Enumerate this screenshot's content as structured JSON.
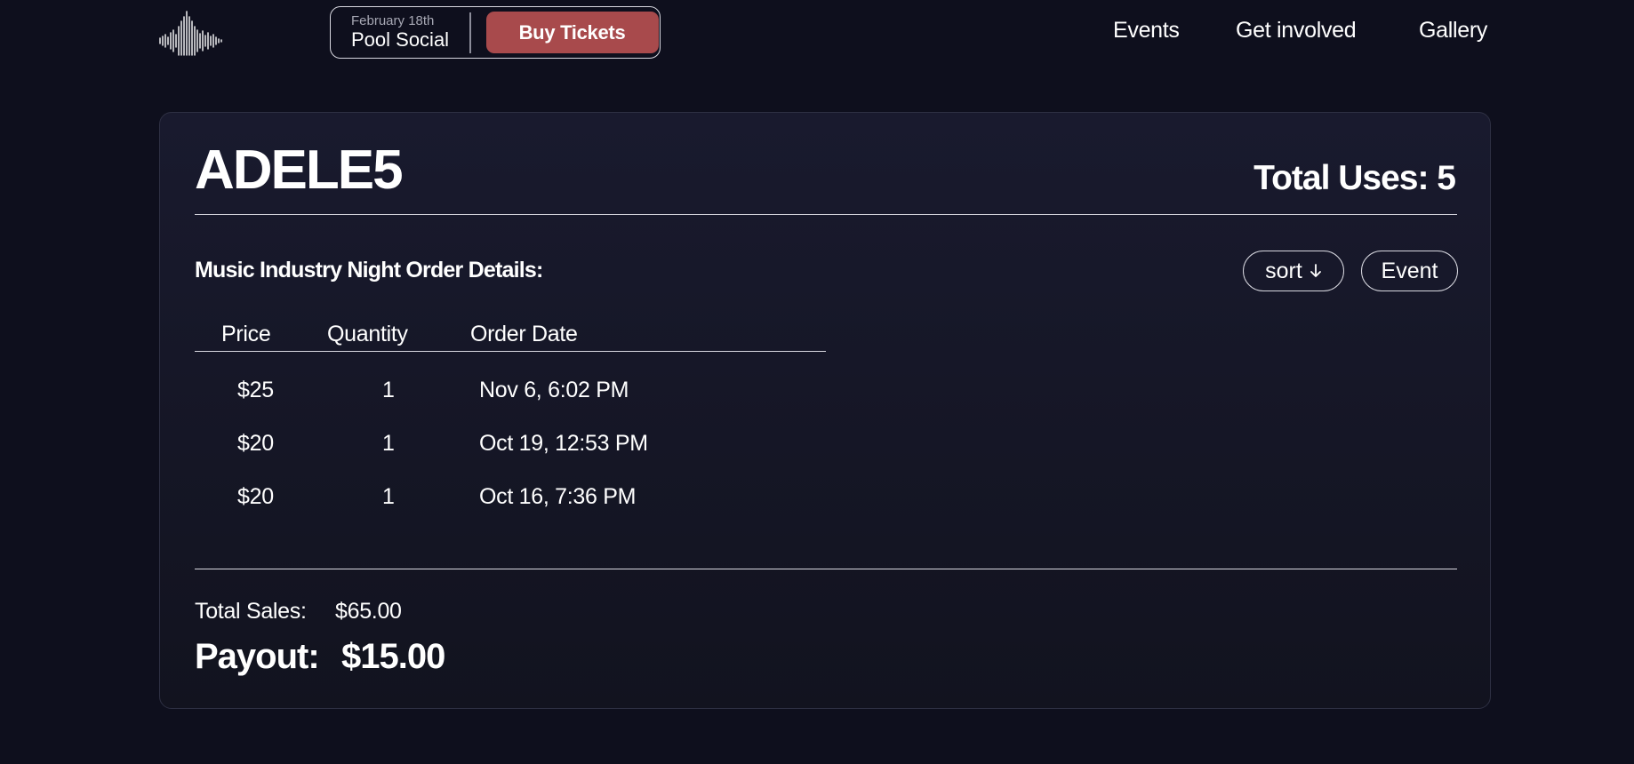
{
  "header": {
    "logo_icon": "soundwave-logo-icon",
    "promo": {
      "date": "February 18th",
      "name": "Pool Social",
      "button_label": "Buy Tickets",
      "button_color": "#a84a4c"
    },
    "nav": {
      "events": "Events",
      "get_involved": "Get involved",
      "gallery": "Gallery"
    }
  },
  "card": {
    "code": "ADELE5",
    "total_uses": "Total Uses: 5",
    "section_title": "Music Industry Night Order Details:",
    "sort_label": "sort",
    "sort_icon": "arrow-down-icon",
    "event_label": "Event",
    "table": {
      "headers": {
        "price": "Price",
        "quantity": "Quantity",
        "order_date": "Order Date"
      },
      "rows": [
        {
          "price": "$25",
          "quantity": "1",
          "order_date": "Nov 6, 6:02 PM"
        },
        {
          "price": "$20",
          "quantity": "1",
          "order_date": "Oct 19, 12:53 PM"
        },
        {
          "price": "$20",
          "quantity": "1",
          "order_date": "Oct 16, 7:36 PM"
        }
      ]
    },
    "totals": {
      "sales_label": "Total Sales:",
      "sales_value": "$65.00",
      "payout_label": "Payout:",
      "payout_value": "$15.00"
    }
  },
  "colors": {
    "background": "#0e0f1d",
    "accent": "#a84a4c",
    "text": "#ffffff"
  }
}
